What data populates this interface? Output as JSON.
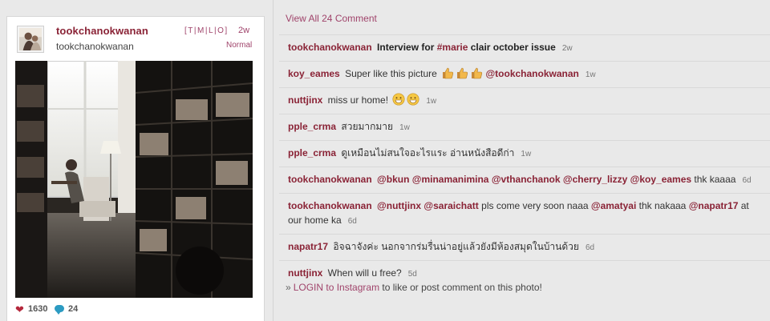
{
  "post": {
    "username": "tookchanokwanan",
    "full_name": "tookchanokwanan",
    "size_links": [
      "[",
      "T",
      "|",
      "M",
      "|",
      "L",
      "|",
      "O",
      "]"
    ],
    "time": "2w",
    "filter": "Normal",
    "likes": "1630",
    "comments_count": "24",
    "colors": {
      "accent": "#8a2336",
      "link": "#a0446b",
      "heart": "#b4283c",
      "comment_icon": "#2c9bc2"
    }
  },
  "view_all": "View All 24 Comment",
  "comments": [
    {
      "user": "tookchanokwanan",
      "parts": [
        {
          "t": "text",
          "v": "Interview for "
        },
        {
          "t": "tag",
          "v": "#marie"
        },
        {
          "t": "text",
          "v": " clair october issue"
        }
      ],
      "time": "2w"
    },
    {
      "user": "koy_eames",
      "parts": [
        {
          "t": "text",
          "v": "Super like this picture "
        },
        {
          "t": "emoji",
          "v": "thumbs-up"
        },
        {
          "t": "emoji",
          "v": "thumbs-up"
        },
        {
          "t": "emoji",
          "v": "thumbs-up"
        },
        {
          "t": "text",
          "v": " "
        },
        {
          "t": "tag",
          "v": "@tookchanokwanan"
        }
      ],
      "time": "1w"
    },
    {
      "user": "nuttjinx",
      "parts": [
        {
          "t": "text",
          "v": "miss ur home! "
        },
        {
          "t": "emoji",
          "v": "grin"
        },
        {
          "t": "emoji",
          "v": "grin"
        }
      ],
      "time": "1w"
    },
    {
      "user": "pple_crma",
      "parts": [
        {
          "t": "text",
          "v": "สวยมากมาย"
        }
      ],
      "time": "1w"
    },
    {
      "user": "pple_crma",
      "parts": [
        {
          "t": "text",
          "v": "ดูเหมือนไม่สนใจอะไรแระ อ่านหนังสือดีก่า"
        }
      ],
      "time": "1w"
    },
    {
      "user": "tookchanokwanan",
      "parts": [
        {
          "t": "tag",
          "v": "@bkun"
        },
        {
          "t": "text",
          "v": " "
        },
        {
          "t": "tag",
          "v": "@minamanimina"
        },
        {
          "t": "text",
          "v": " "
        },
        {
          "t": "tag",
          "v": "@vthanchanok"
        },
        {
          "t": "text",
          "v": " "
        },
        {
          "t": "tag",
          "v": "@cherry_lizzy"
        },
        {
          "t": "text",
          "v": " "
        },
        {
          "t": "tag",
          "v": "@koy_eames"
        },
        {
          "t": "text",
          "v": " thk kaaaa"
        }
      ],
      "time": "6d"
    },
    {
      "user": "tookchanokwanan",
      "parts": [
        {
          "t": "tag",
          "v": "@nuttjinx"
        },
        {
          "t": "text",
          "v": " "
        },
        {
          "t": "tag",
          "v": "@saraichatt"
        },
        {
          "t": "text",
          "v": " pls come very soon naaa "
        },
        {
          "t": "tag",
          "v": "@amatyai"
        },
        {
          "t": "text",
          "v": " thk nakaaa "
        },
        {
          "t": "tag",
          "v": "@napatr17"
        },
        {
          "t": "text",
          "v": " at our home ka"
        }
      ],
      "time": "6d"
    },
    {
      "user": "napatr17",
      "parts": [
        {
          "t": "text",
          "v": "อิจฉาจังค่ะ นอกจากร่มรื่นน่าอยู่แล้วยังมีห้องสมุดในบ้านด้วย"
        }
      ],
      "time": "6d"
    },
    {
      "user": "nuttjinx",
      "parts": [
        {
          "t": "text",
          "v": "When will u free?"
        }
      ],
      "time": "5d"
    }
  ],
  "login": {
    "prefix": "»",
    "link": "LOGIN to Instagram",
    "suffix": " to like or post comment on this photo!"
  }
}
